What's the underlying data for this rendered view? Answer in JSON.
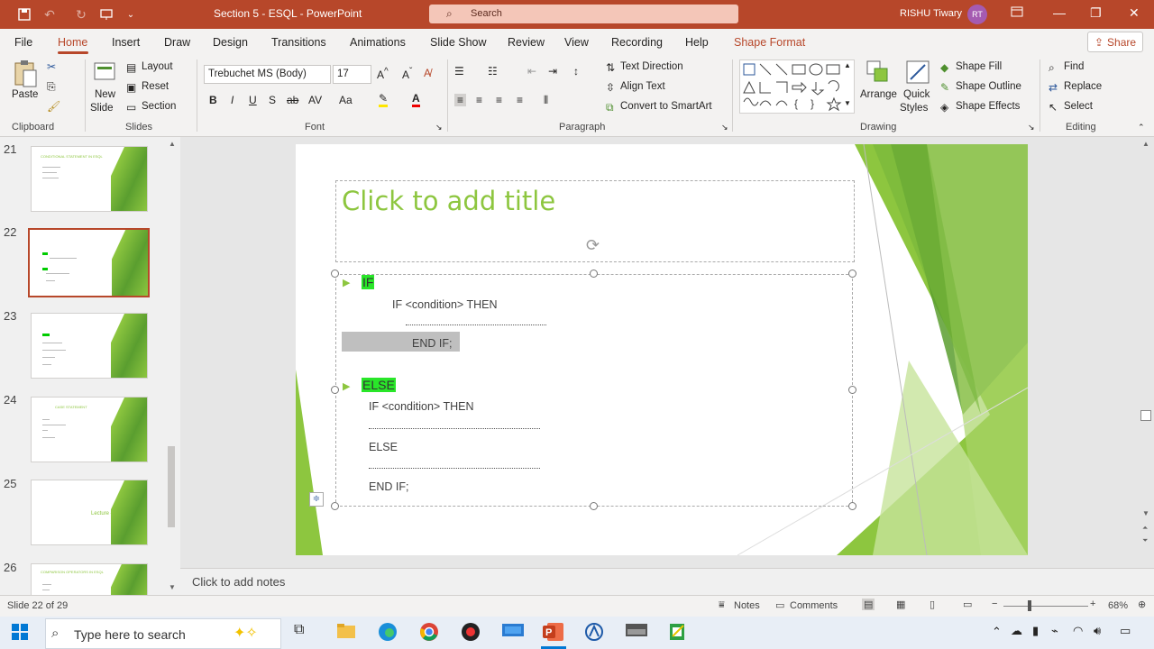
{
  "titlebar": {
    "title": "Section 5 - ESQL  -  PowerPoint",
    "search_placeholder": "Search",
    "user": "RISHU Tiwary",
    "initials": "RT"
  },
  "menu": {
    "tabs": [
      "File",
      "Home",
      "Insert",
      "Draw",
      "Design",
      "Transitions",
      "Animations",
      "Slide Show",
      "Review",
      "View",
      "Recording",
      "Help",
      "Shape Format"
    ],
    "share": "Share"
  },
  "ribbon": {
    "clipboard": {
      "paste": "Paste",
      "group": "Clipboard"
    },
    "slides": {
      "new_slide": "New",
      "new_slide2": "Slide",
      "layout": "Layout",
      "reset": "Reset",
      "section": "Section",
      "group": "Slides"
    },
    "font": {
      "family": "Trebuchet MS (Body)",
      "size": "17",
      "bold": "B",
      "italic": "I",
      "underline": "U",
      "strike": "S",
      "strike2": "ab",
      "spacing": "AV",
      "case": "Aa",
      "group": "Font"
    },
    "paragraph": {
      "text_direction": "Text Direction",
      "align_text": "Align Text",
      "convert": "Convert to SmartArt",
      "group": "Paragraph"
    },
    "drawing": {
      "arrange": "Arrange",
      "quick": "Quick",
      "styles": "Styles",
      "fill": "Shape Fill",
      "outline": "Shape Outline",
      "effects": "Shape Effects",
      "group": "Drawing"
    },
    "editing": {
      "find": "Find",
      "replace": "Replace",
      "select": "Select",
      "group": "Editing"
    }
  },
  "thumbs": [
    {
      "num": "21",
      "title": "CONDITIONAL STATEMENT IN ESQL"
    },
    {
      "num": "22",
      "title": ""
    },
    {
      "num": "23",
      "title": ""
    },
    {
      "num": "24",
      "title": "CASE STATEMENT"
    },
    {
      "num": "25",
      "title": "Lecture 4"
    },
    {
      "num": "26",
      "title": "COMPARISON OPERATORS IN ESQL"
    }
  ],
  "slide": {
    "title_placeholder": "Click to add title",
    "if_label": "IF",
    "if_cond": "IF <condition> THEN",
    "end_if1": "END IF;",
    "else_label": "ELSE",
    "if_cond2": "IF <condition> THEN",
    "else2": "ELSE",
    "end_if2": "END IF;"
  },
  "notes": {
    "placeholder": "Click to add notes"
  },
  "status": {
    "slide_info": "Slide 22 of 29",
    "notes": "Notes",
    "comments": "Comments",
    "zoom": "68%"
  },
  "taskbar": {
    "search_placeholder": "Type here to search"
  }
}
